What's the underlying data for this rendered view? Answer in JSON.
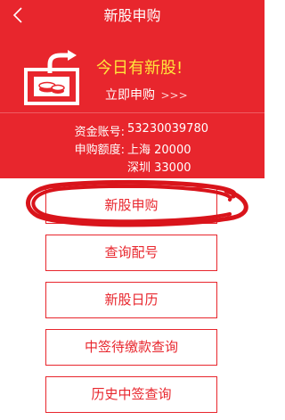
{
  "header": {
    "title": "新股申购"
  },
  "hero": {
    "headline": "今日有新股!",
    "link_label": "立即申购",
    "link_arrows": ">>>",
    "account_label": "资金账号:",
    "account_value": "53230039780",
    "quota_label": "申购额度:",
    "quota_sh": "上海 20000",
    "quota_sz": "深圳 33000"
  },
  "actions": {
    "subscribe": "新股申购",
    "query_allot": "查询配号",
    "ipo_calendar": "新股日历",
    "pay_query": "中签待缴款查询",
    "history_query": "历史中签查询"
  },
  "colors": {
    "brand_red": "#e8262d",
    "headline_yellow": "#ffe53b"
  }
}
